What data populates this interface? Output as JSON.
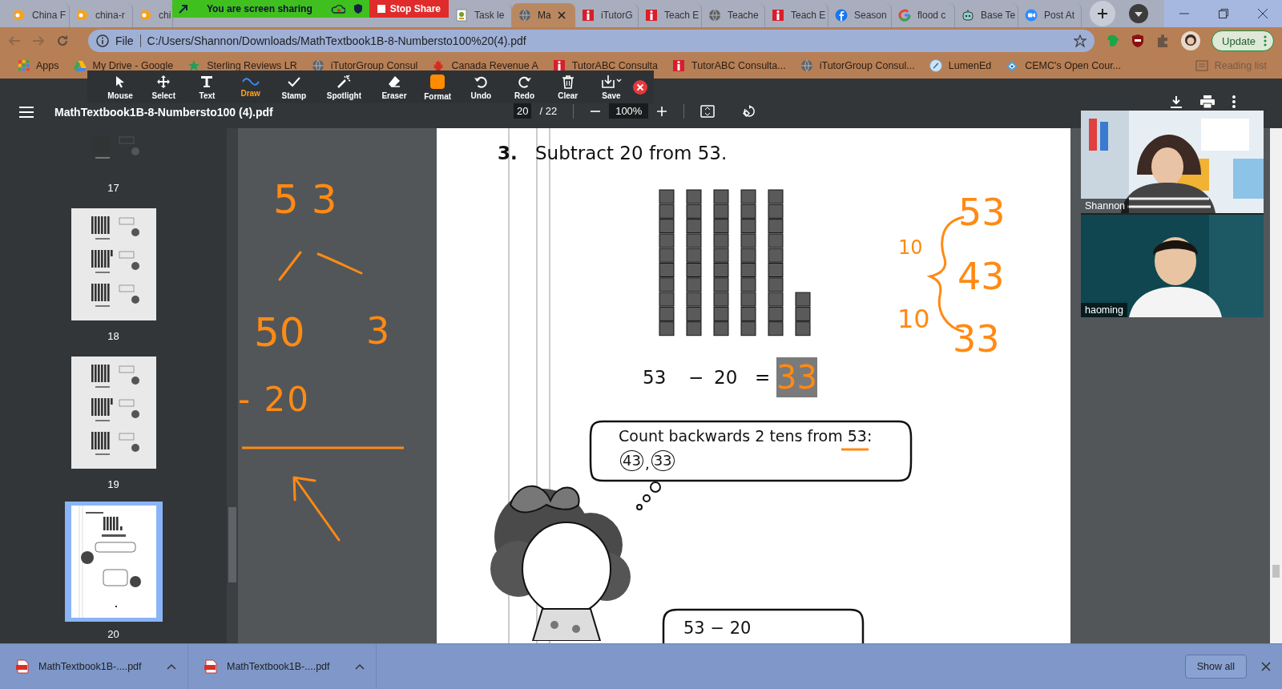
{
  "browser": {
    "tabs": [
      {
        "label": "China F",
        "kind": "os",
        "selected": false
      },
      {
        "label": "china-r",
        "kind": "os",
        "selected": false
      },
      {
        "label": "chi",
        "kind": "os",
        "selected": false
      },
      {
        "label": "Task le",
        "kind": "doc",
        "selected": false
      },
      {
        "label": "Ma",
        "kind": "globe",
        "selected": true
      },
      {
        "label": "iTutorG",
        "kind": "itutor",
        "selected": false
      },
      {
        "label": "Teach E",
        "kind": "itutor",
        "selected": false
      },
      {
        "label": "Teache",
        "kind": "globe",
        "selected": false
      },
      {
        "label": "Teach E",
        "kind": "itutor",
        "selected": false
      },
      {
        "label": "Season",
        "kind": "facebook",
        "selected": false
      },
      {
        "label": "flood c",
        "kind": "google",
        "selected": false
      },
      {
        "label": "Base Te",
        "kind": "robot",
        "selected": false
      },
      {
        "label": "Post At",
        "kind": "video",
        "selected": false
      }
    ],
    "address": {
      "scheme": "File",
      "url": "C:/Users/Shannon/Downloads/MathTextbook1B-8-Numbersto100%20(4).pdf"
    },
    "update_button": "Update",
    "bookmarks": [
      {
        "label": "Apps",
        "kind": "apps"
      },
      {
        "label": "My Drive - Google",
        "kind": "drive"
      },
      {
        "label": "Sterling Reviews LR",
        "kind": "star"
      },
      {
        "label": "iTutorGroup Consul",
        "kind": "globe"
      },
      {
        "label": "Canada Revenue A",
        "kind": "leaf"
      },
      {
        "label": "TutorABC Consulta",
        "kind": "itutor"
      },
      {
        "label": "TutorABC Consulta...",
        "kind": "itutor"
      },
      {
        "label": "iTutorGroup Consul...",
        "kind": "globe"
      },
      {
        "label": "LumenEd",
        "kind": "lumen"
      },
      {
        "label": "CEMC's Open Cour...",
        "kind": "cemc"
      }
    ],
    "reading_list": "Reading list"
  },
  "share_banner": {
    "status": "You are screen sharing",
    "stop": "Stop Share"
  },
  "annotate_tools": [
    {
      "label": "Mouse",
      "kind": "mouse",
      "selected": false
    },
    {
      "label": "Select",
      "kind": "select",
      "selected": false
    },
    {
      "label": "Text",
      "kind": "text",
      "selected": false
    },
    {
      "label": "Draw",
      "kind": "draw",
      "selected": true
    },
    {
      "label": "Stamp",
      "kind": "stamp",
      "selected": false
    },
    {
      "label": "Spotlight",
      "kind": "spotlight",
      "selected": false
    },
    {
      "label": "Eraser",
      "kind": "eraser",
      "selected": false
    },
    {
      "label": "Format",
      "kind": "format",
      "selected": false
    },
    {
      "label": "Undo",
      "kind": "undo",
      "selected": false
    },
    {
      "label": "Redo",
      "kind": "redo",
      "selected": false
    },
    {
      "label": "Clear",
      "kind": "clear",
      "selected": false
    },
    {
      "label": "Save",
      "kind": "save",
      "selected": false
    }
  ],
  "pdf": {
    "filename": "MathTextbook1B-8-Numbersto100 (4).pdf",
    "page": "20",
    "total": "/ 22",
    "zoom": "100%"
  },
  "thumbnails": [
    {
      "page": "17",
      "selected": false
    },
    {
      "page": "18",
      "selected": false
    },
    {
      "page": "19",
      "selected": false
    },
    {
      "page": "20",
      "selected": true
    }
  ],
  "whiteboard": {
    "notes": [
      "5 3",
      "50",
      "3",
      "- 20"
    ]
  },
  "page": {
    "number": "3.",
    "title": "Subtract 20 from 53.",
    "equation": [
      "53",
      "−",
      "20",
      "="
    ],
    "answer": "33",
    "bubble": {
      "text": "Count backwards 2 tens from 53:",
      "circled": [
        "43",
        "33"
      ],
      "separator": ","
    },
    "bottom_bubble": "53 − 20",
    "annotations": [
      "53",
      "10",
      "43",
      "10",
      "33"
    ]
  },
  "video": [
    {
      "name": "Shannon"
    },
    {
      "name": "haoming"
    }
  ],
  "downloads": [
    {
      "file": "MathTextbook1B-....pdf"
    },
    {
      "file": "MathTextbook1B-....pdf"
    }
  ],
  "show_all": "Show all"
}
